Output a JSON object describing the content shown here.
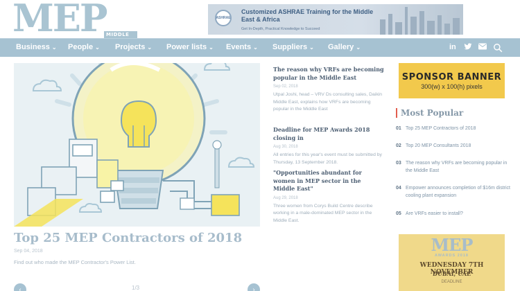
{
  "header": {
    "logo_text": "MEP",
    "logo_region": "MIDDLE EAST",
    "top_ad": {
      "badge": "ASHRAE",
      "title": "Customized ASHRAE Training for the Middle East & Africa",
      "subtitle": "Get In-Depth, Practical Knowledge to Succeed"
    }
  },
  "nav": {
    "items": [
      {
        "label": "Business"
      },
      {
        "label": "People"
      },
      {
        "label": "Projects"
      },
      {
        "label": "Power lists"
      },
      {
        "label": "Events"
      },
      {
        "label": "Suppliers"
      },
      {
        "label": "Gallery"
      }
    ],
    "chevron": "⌄",
    "icons": [
      "linkedin-icon",
      "twitter-icon",
      "mail-icon",
      "search-icon"
    ]
  },
  "hero": {
    "title": "Top 25 MEP Contractors of 2018",
    "date": "Sep 04, 2018",
    "description": "Find out who made the MEP Contractor's Power List.",
    "pager": {
      "current": "1/3",
      "prev": "‹",
      "next": "›"
    }
  },
  "news": [
    {
      "title": "The reason why VRFs are becoming popular in the Middle East",
      "date": "Sep 02, 2018",
      "summary": "Utpal Joshi, head – VRV Ds consulting sales, Daikin Middle East, explains how VRFs are becoming popular in the Middle East"
    },
    {
      "title": "Deadline for MEP Awards 2018 closing in",
      "date": "Aug 30, 2018",
      "summary": "All entries for this year's event must be submitted by Thursday, 13 September 2018."
    },
    {
      "title": "\"Opportunities abundant for women in MEP sector in the Middle East\"",
      "date": "Aug 29, 2018",
      "summary": "Three women from Corys Build Centre describe working in a male-dominated MEP sector in the Middle East."
    }
  ],
  "sponsor": {
    "title": "SPONSOR BANNER",
    "size": "300(w) x 100(h) pixels"
  },
  "most_popular": {
    "heading": "Most Popular",
    "items": [
      {
        "num": "01",
        "text": "Top 25 MEP Contractors of 2018"
      },
      {
        "num": "02",
        "text": "Top 20 MEP Consultants 2018"
      },
      {
        "num": "03",
        "text": "The reason why VRFs are becoming popular in the Middle East"
      },
      {
        "num": "04",
        "text": "Empower announces completion of $16m district cooling plant expansion"
      },
      {
        "num": "05",
        "text": "Are VRFs easier to install?"
      }
    ]
  },
  "awards_ad": {
    "logo": "MEP",
    "subtitle": "AWARDS 2018",
    "date": "WEDNESDAY 7TH NOVEMBER",
    "place": "DUBAI, UAE",
    "note": "DEADLINE"
  },
  "colors": {
    "accent": "#a6c2d2",
    "sponsor": "#f2c94c",
    "popular_bar": "#e25d4e"
  }
}
